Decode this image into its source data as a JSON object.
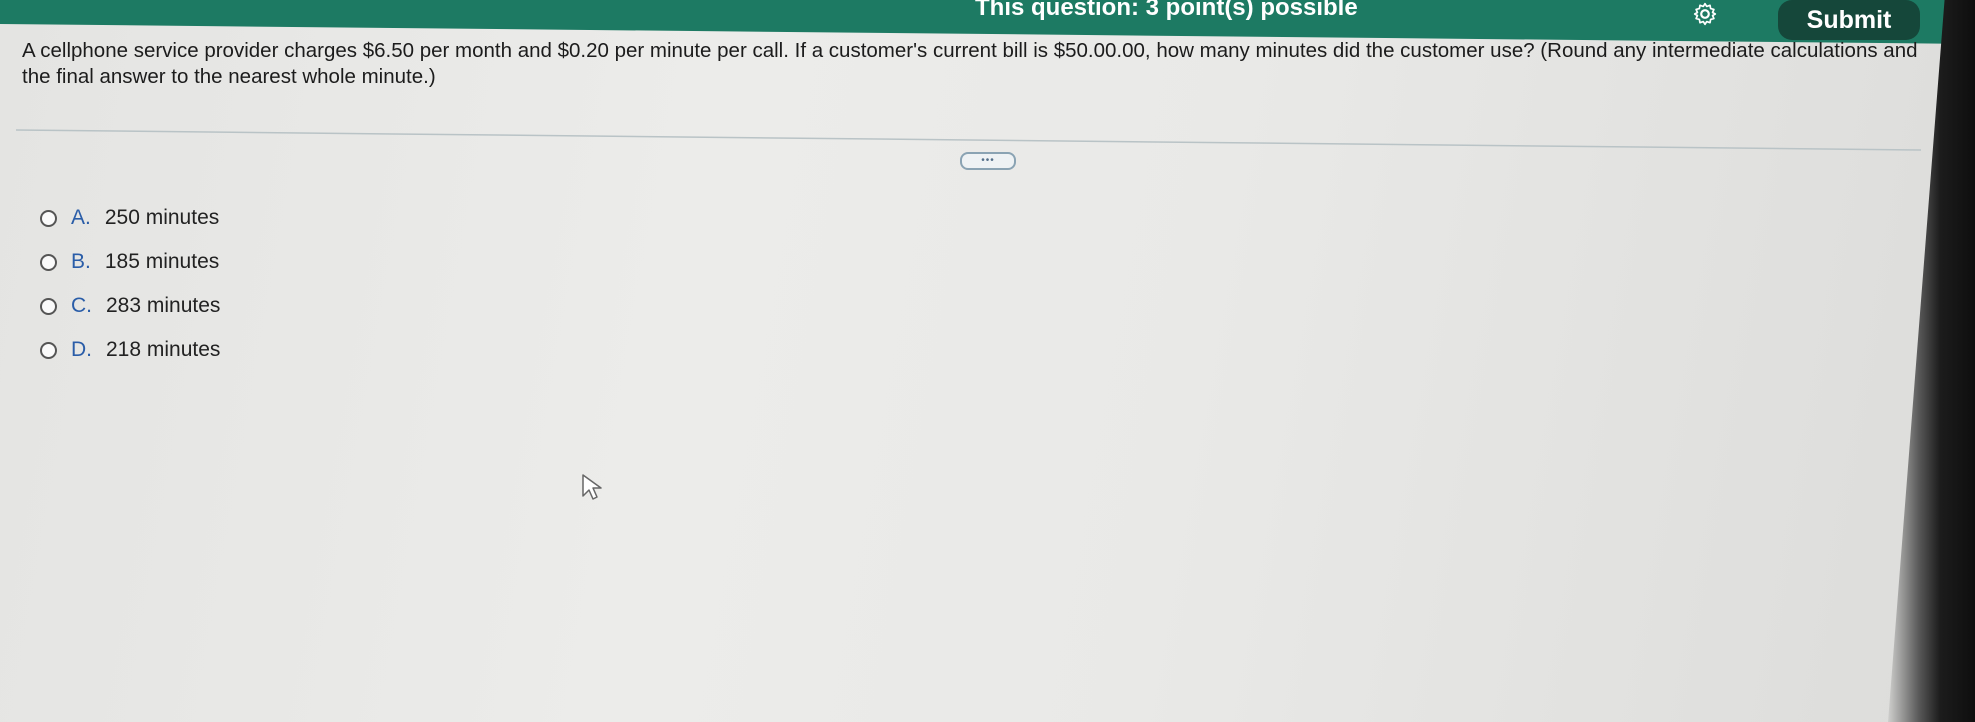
{
  "header": {
    "points_text": "This question: 3 point(s) possible",
    "settings_icon": "gear-icon",
    "submit_label": "Submit",
    "bar_color": "#1d7a63",
    "submit_color": "#15473a"
  },
  "question": {
    "text": "A cellphone service provider charges $6.50 per month and $0.20 per minute per call. If a customer's current bill is $50.00.00, how many minutes did the customer use? (Round any intermediate calculations and the final answer to the nearest whole minute.)"
  },
  "more_button": {
    "label": "•••"
  },
  "options": [
    {
      "letter": "A.",
      "text": "250 minutes"
    },
    {
      "letter": "B.",
      "text": "185 minutes"
    },
    {
      "letter": "C.",
      "text": "283 minutes"
    },
    {
      "letter": "D.",
      "text": "218 minutes"
    }
  ],
  "cursor_icon": "pointer-cursor-icon"
}
